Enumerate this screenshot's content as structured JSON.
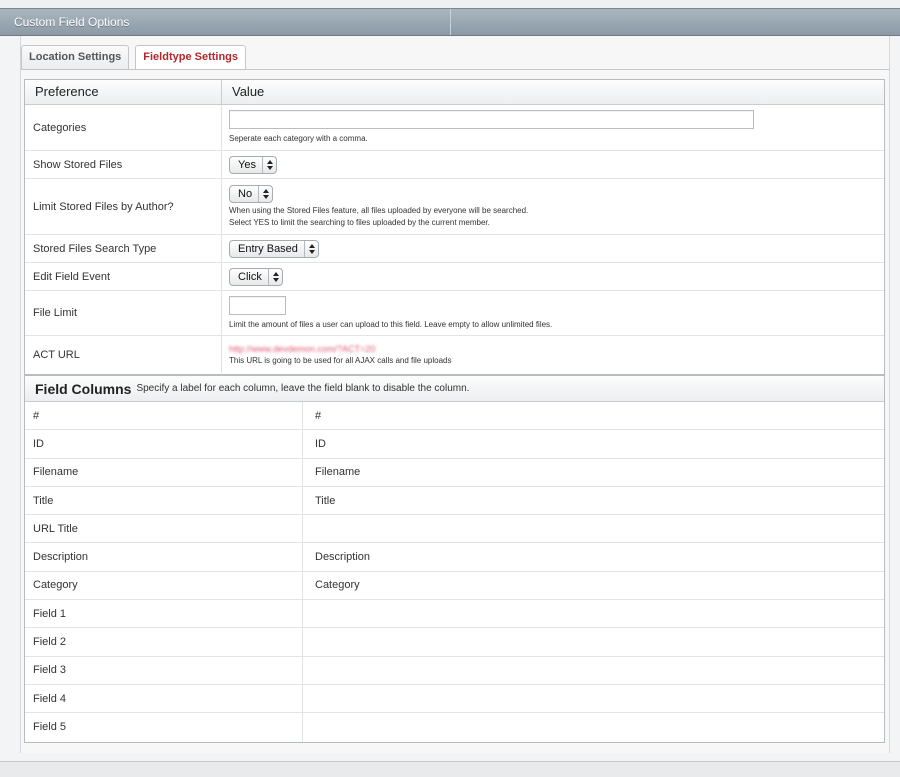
{
  "panel": {
    "title": "Custom Field Options"
  },
  "tabs": [
    {
      "label": "Location Settings",
      "active": false
    },
    {
      "label": "Fieldtype Settings",
      "active": true
    }
  ],
  "prefs_table": {
    "headers": {
      "preference": "Preference",
      "value": "Value"
    },
    "rows": {
      "categories": {
        "label": "Categories",
        "input_value": "",
        "help": "Seperate each category with a comma."
      },
      "show_stored": {
        "label": "Show Stored Files",
        "selected": "Yes"
      },
      "limit_author": {
        "label": "Limit Stored Files by Author?",
        "selected": "No",
        "help1": "When using the Stored Files feature, all files uploaded by everyone will be searched.",
        "help2": "Select YES to limit the searching to files uploaded by the current member."
      },
      "search_type": {
        "label": "Stored Files Search Type",
        "selected": "Entry Based"
      },
      "edit_event": {
        "label": "Edit Field Event",
        "selected": "Click"
      },
      "file_limit": {
        "label": "File Limit",
        "input_value": "",
        "help": "Limit the amount of files a user can upload to this field. Leave empty to allow unlimited files."
      },
      "act_url": {
        "label": "ACT URL",
        "url": "http://www.devdemon.com/?ACT=20",
        "help": "This URL is going to be used for all AJAX calls and file uploads"
      }
    }
  },
  "field_columns": {
    "title": "Field Columns",
    "description": "Specify a label for each column, leave the field blank to disable the column.",
    "rows": [
      {
        "name": "#",
        "value": "#"
      },
      {
        "name": "ID",
        "value": "ID"
      },
      {
        "name": "Filename",
        "value": "Filename"
      },
      {
        "name": "Title",
        "value": "Title"
      },
      {
        "name": "URL Title",
        "value": ""
      },
      {
        "name": "Description",
        "value": "Description"
      },
      {
        "name": "Category",
        "value": "Category"
      },
      {
        "name": "Field 1",
        "value": ""
      },
      {
        "name": "Field 2",
        "value": ""
      },
      {
        "name": "Field 3",
        "value": ""
      },
      {
        "name": "Field 4",
        "value": ""
      },
      {
        "name": "Field 5",
        "value": ""
      }
    ]
  }
}
